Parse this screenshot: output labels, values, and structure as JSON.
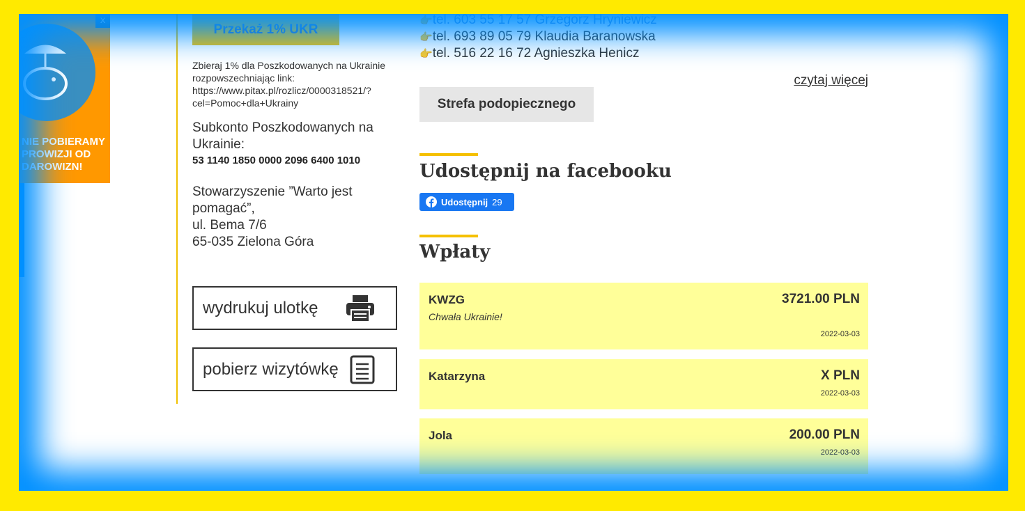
{
  "promo": {
    "text": "Nie pobieramy prowizji od darowizn!",
    "close_label": "X"
  },
  "left": {
    "donate_button": "Przekaż 1% UKR",
    "collect_text": "Zbieraj 1% dla Poszkodowanych na Ukrainie rozpowszechniając link: https://www.pitax.pl/rozlicz/0000318521/?cel=Pomoc+dla+Ukrainy",
    "subkonto_label": "Subkonto Poszkodowanych na Ukrainie:",
    "account_number": "53 1140 1850 0000 2096 6400 1010",
    "address_lines": [
      "Stowarzyszenie ”Warto jest pomagać”,",
      "ul. Bema 7/6",
      "65-035 Zielona Góra"
    ],
    "print_label": "wydrukuj ulotkę",
    "card_label": "pobierz wizytówkę"
  },
  "right": {
    "phones": [
      {
        "text": "tel. 603 55 17 57 Grzegorz Hryniewicz"
      },
      {
        "text": "tel. 693 89 05 79 Klaudia Baranowska"
      },
      {
        "text": "tel. 516 22 16 72 Agnieszka Henicz"
      }
    ],
    "read_more": "czytaj więcej",
    "zone_button": "Strefa podopiecznego",
    "share_heading": "Udostępnij na facebooku",
    "fb_share_label": "Udostępnij",
    "fb_share_count": "29",
    "donations_heading": "Wpłaty",
    "donations": [
      {
        "name": "KWZG",
        "amount": "3721.00 PLN",
        "message": "Chwała Ukrainie!",
        "date": "2022-03-03"
      },
      {
        "name": "Katarzyna",
        "amount": "X PLN",
        "message": "",
        "date": "2022-03-03"
      },
      {
        "name": "Jola",
        "amount": "200.00 PLN",
        "message": "",
        "date": "2022-03-03"
      }
    ]
  },
  "colors": {
    "outer_border": "#ffea00",
    "frame_blue": "#0090ff",
    "accent_yellow": "#f5c000",
    "donation_bg": "#ffff99",
    "facebook_blue": "#1877f2"
  }
}
